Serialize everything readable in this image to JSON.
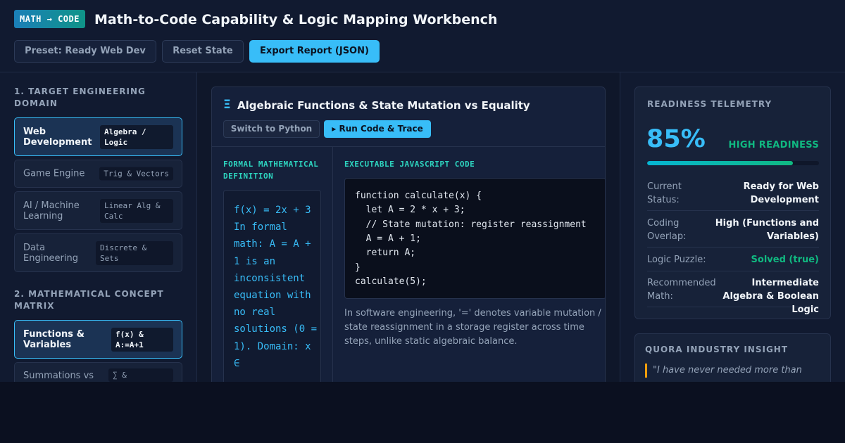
{
  "header": {
    "brand": "MATH → CODE",
    "title": "Math-to-Code Capability & Logic Mapping Workbench",
    "preset_label": "Preset: Ready Web Dev",
    "reset_label": "Reset State",
    "export_label": "Export Report (JSON)"
  },
  "sidebar": {
    "domain_title": "1. TARGET ENGINEERING DOMAIN",
    "domains": [
      {
        "label": "Web Development",
        "tag": "Algebra / Logic",
        "active": true
      },
      {
        "label": "Game Engine",
        "tag": "Trig & Vectors",
        "active": false
      },
      {
        "label": "AI / Machine Learning",
        "tag": "Linear Alg & Calc",
        "active": false
      },
      {
        "label": "Data Engineering",
        "tag": "Discrete & Sets",
        "active": false
      }
    ],
    "concept_title": "2. MATHEMATICAL CONCEPT MATRIX",
    "concepts": [
      {
        "label": "Functions & Variables",
        "tag": "f(x) & A:=A+1",
        "active": true
      },
      {
        "label": "Summations vs",
        "tag": "∑ &",
        "active": false
      }
    ]
  },
  "main": {
    "card_icon": "Ξ",
    "card_title": "Algebraic Functions & State Mutation vs Equality",
    "python_label": "Switch to Python",
    "run_label": "▸ Run Code & Trace",
    "math_label": "FORMAL MATHEMATICAL DEFINITION",
    "math_text": "f(x) = 2x + 3\nIn formal math: A = A + 1 is an inconsistent equation with no real solutions (0 = 1). Domain: x ∈",
    "code_label": "EXECUTABLE JAVASCRIPT CODE",
    "code_lines": [
      "function calculate(x) {",
      "  let A = 2 * x + 3;",
      "  // State mutation: register reassignment",
      "  A = A + 1;",
      "  return A;",
      "}",
      "calculate(5);"
    ],
    "explanation": "In software engineering, '=' denotes variable mutation / state reassignment in a storage register across time steps, unlike static algebraic balance."
  },
  "telemetry": {
    "title": "READINESS TELEMETRY",
    "percent": "85%",
    "progress": 0.85,
    "status": "HIGH READINESS",
    "rows": [
      {
        "key": "Current Status:",
        "value": "Ready for Web Development",
        "ok": false
      },
      {
        "key": "Coding Overlap:",
        "value": "High (Functions and Variables)",
        "ok": false
      },
      {
        "key": "Logic Puzzle:",
        "value": "Solved (true)",
        "ok": true
      },
      {
        "key": "Recommended Math:",
        "value": "Intermediate Algebra & Boolean Logic",
        "ok": false
      }
    ]
  },
  "insight": {
    "title": "QUORA INDUSTRY INSIGHT",
    "quote": "\"I have never needed more than"
  }
}
